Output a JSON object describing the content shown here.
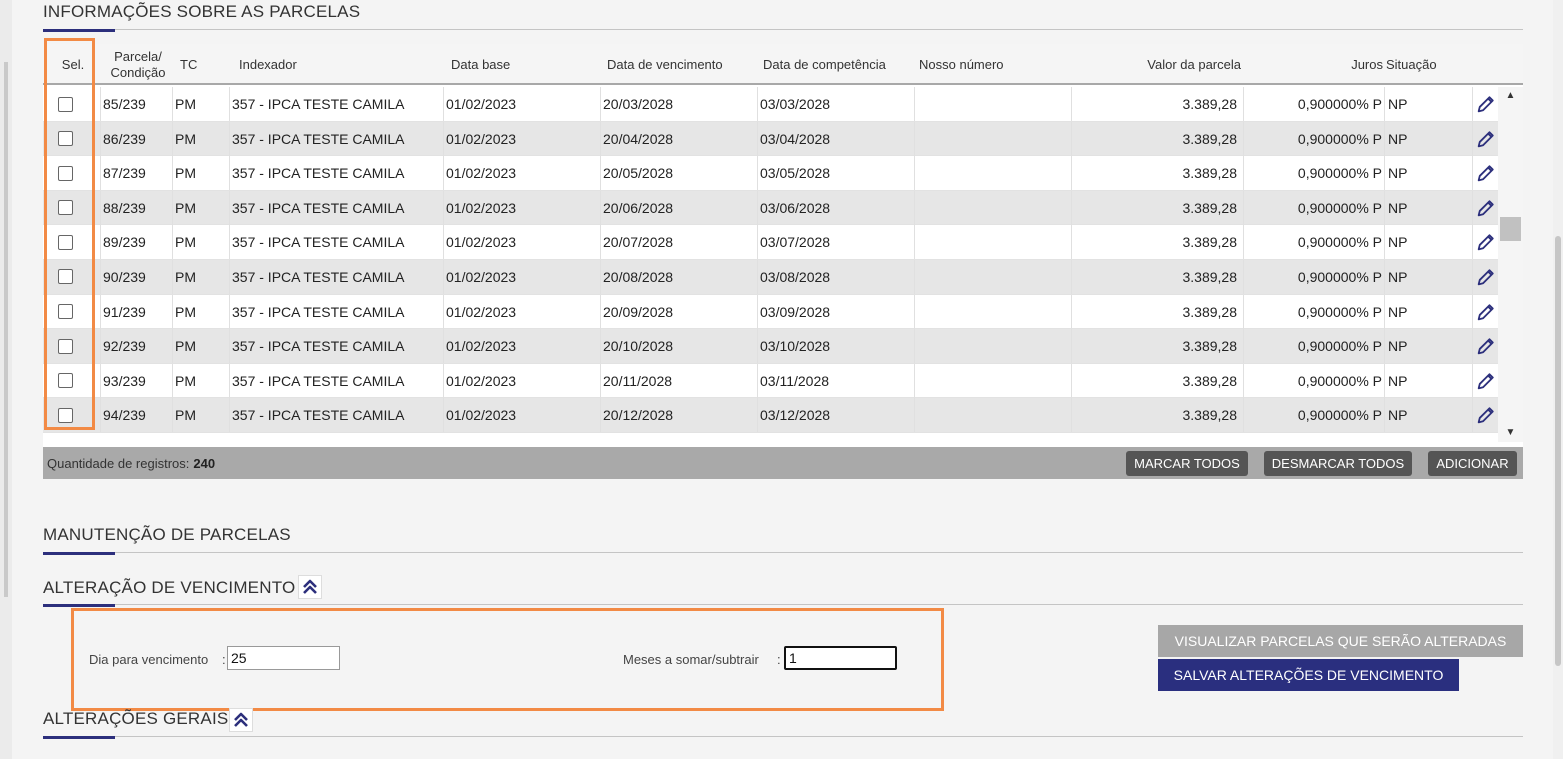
{
  "section_parcelas": {
    "title": "INFORMAÇÕES SOBRE AS PARCELAS"
  },
  "table": {
    "headers": {
      "sel": "Sel.",
      "parcela_line1": "Parcela/",
      "parcela_line2": "Condição",
      "tc": "TC",
      "indexador": "Indexador",
      "data_base": "Data base",
      "data_vencimento": "Data de vencimento",
      "data_competencia": "Data de competência",
      "nosso_numero": "Nosso número",
      "valor_parcela": "Valor da parcela",
      "juros": "Juros",
      "situacao": "Situação"
    },
    "rows": [
      {
        "parcela": "85/239",
        "tc": "PM",
        "indexador": "357 - IPCA TESTE CAMILA",
        "data_base": "01/02/2023",
        "vencimento": "20/03/2028",
        "competencia": "03/03/2028",
        "nosso_numero": "",
        "valor": "3.389,28",
        "juros": "0,900000% P",
        "situacao": "NP"
      },
      {
        "parcela": "86/239",
        "tc": "PM",
        "indexador": "357 - IPCA TESTE CAMILA",
        "data_base": "01/02/2023",
        "vencimento": "20/04/2028",
        "competencia": "03/04/2028",
        "nosso_numero": "",
        "valor": "3.389,28",
        "juros": "0,900000% P",
        "situacao": "NP"
      },
      {
        "parcela": "87/239",
        "tc": "PM",
        "indexador": "357 - IPCA TESTE CAMILA",
        "data_base": "01/02/2023",
        "vencimento": "20/05/2028",
        "competencia": "03/05/2028",
        "nosso_numero": "",
        "valor": "3.389,28",
        "juros": "0,900000% P",
        "situacao": "NP"
      },
      {
        "parcela": "88/239",
        "tc": "PM",
        "indexador": "357 - IPCA TESTE CAMILA",
        "data_base": "01/02/2023",
        "vencimento": "20/06/2028",
        "competencia": "03/06/2028",
        "nosso_numero": "",
        "valor": "3.389,28",
        "juros": "0,900000% P",
        "situacao": "NP"
      },
      {
        "parcela": "89/239",
        "tc": "PM",
        "indexador": "357 - IPCA TESTE CAMILA",
        "data_base": "01/02/2023",
        "vencimento": "20/07/2028",
        "competencia": "03/07/2028",
        "nosso_numero": "",
        "valor": "3.389,28",
        "juros": "0,900000% P",
        "situacao": "NP"
      },
      {
        "parcela": "90/239",
        "tc": "PM",
        "indexador": "357 - IPCA TESTE CAMILA",
        "data_base": "01/02/2023",
        "vencimento": "20/08/2028",
        "competencia": "03/08/2028",
        "nosso_numero": "",
        "valor": "3.389,28",
        "juros": "0,900000% P",
        "situacao": "NP"
      },
      {
        "parcela": "91/239",
        "tc": "PM",
        "indexador": "357 - IPCA TESTE CAMILA",
        "data_base": "01/02/2023",
        "vencimento": "20/09/2028",
        "competencia": "03/09/2028",
        "nosso_numero": "",
        "valor": "3.389,28",
        "juros": "0,900000% P",
        "situacao": "NP"
      },
      {
        "parcela": "92/239",
        "tc": "PM",
        "indexador": "357 - IPCA TESTE CAMILA",
        "data_base": "01/02/2023",
        "vencimento": "20/10/2028",
        "competencia": "03/10/2028",
        "nosso_numero": "",
        "valor": "3.389,28",
        "juros": "0,900000% P",
        "situacao": "NP"
      },
      {
        "parcela": "93/239",
        "tc": "PM",
        "indexador": "357 - IPCA TESTE CAMILA",
        "data_base": "01/02/2023",
        "vencimento": "20/11/2028",
        "competencia": "03/11/2028",
        "nosso_numero": "",
        "valor": "3.389,28",
        "juros": "0,900000% P",
        "situacao": "NP"
      },
      {
        "parcela": "94/239",
        "tc": "PM",
        "indexador": "357 - IPCA TESTE CAMILA",
        "data_base": "01/02/2023",
        "vencimento": "20/12/2028",
        "competencia": "03/12/2028",
        "nosso_numero": "",
        "valor": "3.389,28",
        "juros": "0,900000% P",
        "situacao": "NP"
      }
    ],
    "footer": {
      "count_label": "Quantidade de registros:",
      "count_value": "240",
      "mark_all": "MARCAR TODOS",
      "unmark_all": "DESMARCAR TODOS",
      "add": "ADICIONAR"
    }
  },
  "manutencao": {
    "title": "MANUTENÇÃO DE PARCELAS"
  },
  "alteracao_vencimento": {
    "title": "ALTERAÇÃO DE VENCIMENTO",
    "dia_label": "Dia para vencimento",
    "dia_value": "25",
    "meses_label": "Meses a somar/subtrair",
    "meses_value": "1",
    "visualizar_button": "VISUALIZAR PARCELAS QUE SERÃO ALTERADAS",
    "salvar_button": "SALVAR ALTERAÇÕES DE VENCIMENTO"
  },
  "alteracoes_gerais": {
    "title": "ALTERAÇÕES GERAIS"
  },
  "colors": {
    "accent_navy": "#2a2f7f",
    "highlight_orange": "#f28a45",
    "footer_gray": "#a9a9a9",
    "row_alt": "#e6e6e6"
  },
  "icons": [
    "pencil-icon",
    "chevron-double-up-icon",
    "scroll-up-arrow-icon",
    "scroll-down-arrow-icon"
  ]
}
